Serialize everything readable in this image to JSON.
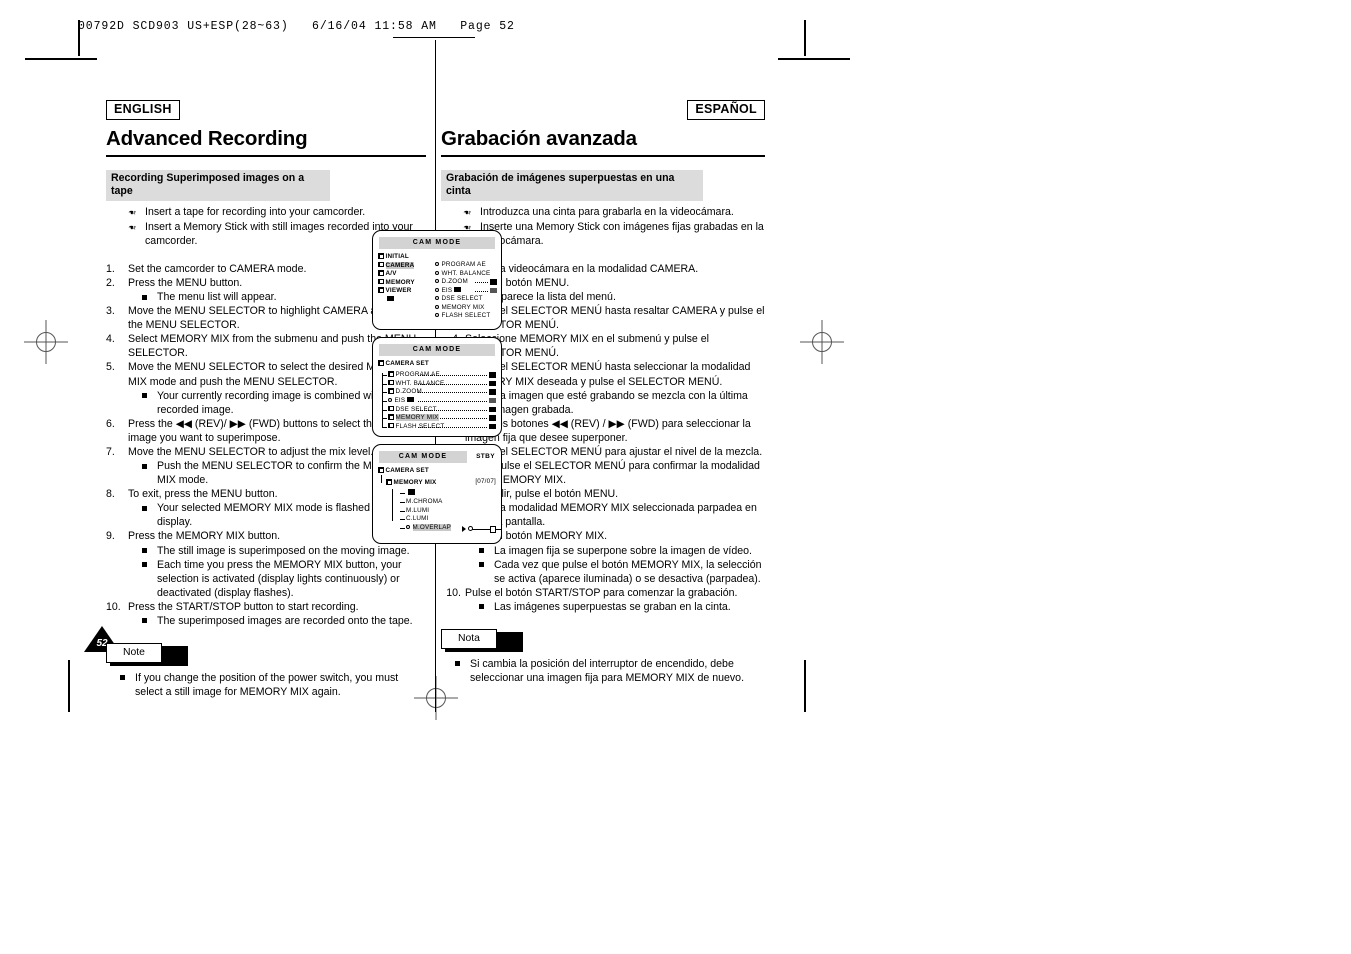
{
  "printer_slug": "00792D SCD903 US+ESP(28~63)   6/16/04 11:58 AM   Page 52",
  "page_number": "52",
  "english": {
    "lang_tag": "ENGLISH",
    "title": "Advanced Recording",
    "section_heading": "Recording Superimposed images on a tape",
    "prereqs": [
      "Insert a tape for recording into your camcorder.",
      "Insert a Memory Stick with still images recorded into your camcorder."
    ],
    "steps": [
      {
        "text": "Set the camcorder to CAMERA mode.",
        "subs": []
      },
      {
        "text": "Press the MENU button.",
        "subs": [
          "The menu list will appear."
        ]
      },
      {
        "text": "Move the MENU SELECTOR to highlight CAMERA and push the MENU SELECTOR.",
        "subs": []
      },
      {
        "text": "Select MEMORY MIX from the submenu and push the MENU SELECTOR.",
        "subs": []
      },
      {
        "text": "Move the MENU SELECTOR to select the desired MEMORY MIX mode and push the MENU SELECTOR.",
        "subs": [
          "Your currently recording image is combined with the last recorded image."
        ]
      },
      {
        "text": "Press the ◀◀ (REV)/ ▶▶ (FWD) buttons to select the still image you want to superimpose.",
        "subs": []
      },
      {
        "text": "Move the MENU SELECTOR to adjust the mix level.",
        "subs": [
          "Push the MENU SELECTOR to confirm the MEMORY MIX mode."
        ]
      },
      {
        "text": "To exit, press the MENU button.",
        "subs": [
          "Your selected MEMORY MIX mode is flashed in the display."
        ]
      },
      {
        "text": "Press the MEMORY MIX button.",
        "subs": [
          "The still image is superimposed on the moving image.",
          "Each time you press the MEMORY MIX button, your selection is activated (display lights continuously) or deactivated (display flashes)."
        ]
      },
      {
        "text": "Press the START/STOP button to start recording.",
        "subs": [
          "The superimposed images are recorded onto the tape."
        ]
      }
    ],
    "note_label": "Note",
    "note_items": [
      "If you change the position of the power switch, you must select a still image for MEMORY MIX again."
    ]
  },
  "spanish": {
    "lang_tag": "ESPAÑOL",
    "title": "Grabación avanzada",
    "section_heading": "Grabación de imágenes superpuestas en una cinta",
    "prereqs": [
      "Introduzca una cinta para grabarla en la videocámara.",
      "Inserte una Memory Stick con imágenes fijas grabadas en la videocámara."
    ],
    "steps": [
      {
        "text": "Ajuste la videocámara en la modalidad CAMERA.",
        "subs": []
      },
      {
        "text": "Pulse el botón MENU.",
        "subs": [
          "Aparece la lista del menú."
        ]
      },
      {
        "text": "Mueva el SELECTOR MENÚ hasta resaltar CAMERA y pulse el SELECTOR MENÚ.",
        "subs": []
      },
      {
        "text": "Seleccione MEMORY MIX en el submenú y pulse el SELECTOR MENÚ.",
        "subs": []
      },
      {
        "text": "Mueva el SELECTOR MENÚ hasta seleccionar la modalidad MEMORY MIX deseada y pulse el SELECTOR MENÚ.",
        "subs": [
          "La imagen que esté grabando se mezcla con la última imagen grabada."
        ]
      },
      {
        "text": "Pulse los botones ◀◀ (REV) / ▶▶ (FWD) para seleccionar la imagen fija que desee superponer.",
        "subs": []
      },
      {
        "text": "Mueva el SELECTOR MENÚ para ajustar el nivel de la mezcla.",
        "subs": [
          "Pulse el SELECTOR MENÚ para confirmar la modalidad MEMORY MIX."
        ]
      },
      {
        "text": "Para salir, pulse el botón MENU.",
        "subs": [
          "La modalidad MEMORY MIX seleccionada parpadea en la pantalla."
        ]
      },
      {
        "text": "Pulse el botón MEMORY MIX.",
        "subs": [
          "La imagen fija se superpone sobre la imagen de vídeo.",
          "Cada vez que pulse el botón MEMORY MIX, la selección se activa (aparece iluminada) o se desactiva (parpadea)."
        ]
      },
      {
        "text": "Pulse el botón START/STOP para comenzar la grabación.",
        "subs": [
          "Las imágenes superpuestas se graban en la cinta."
        ]
      }
    ],
    "note_label": "Nota",
    "note_items": [
      "Si cambia la posición del interruptor de encendido, debe seleccionar una imagen fija para MEMORY MIX de nuevo."
    ]
  },
  "lcd_screens": [
    {
      "title": "CAM MODE",
      "left_menu": [
        "INITIAL",
        "CAMERA",
        "A/V",
        "MEMORY",
        "VIEWER"
      ],
      "left_highlight": "CAMERA",
      "right_menu": [
        "PROGRAM AE",
        "WHT. BALANCE",
        "D.ZOOM",
        "EIS",
        "DSE SELECT",
        "MEMORY MIX",
        "FLASH SELECT"
      ]
    },
    {
      "title": "CAM MODE",
      "root": "CAMERA SET",
      "items": [
        "PROGRAM AE",
        "WHT. BALANCE",
        "D.ZOOM",
        "EIS",
        "DSE SELECT",
        "MEMORY MIX",
        "FLASH SELECT"
      ],
      "highlight": "MEMORY MIX"
    },
    {
      "title": "CAM MODE",
      "status": "STBY",
      "root": "CAMERA SET",
      "index": "[07/07]",
      "submenu_title": "MEMORY MIX",
      "items": [
        "M.CHROMA",
        "M.LUMI",
        "C.LUMI",
        "M.OVERLAP"
      ],
      "highlight": "M.OVERLAP"
    }
  ]
}
